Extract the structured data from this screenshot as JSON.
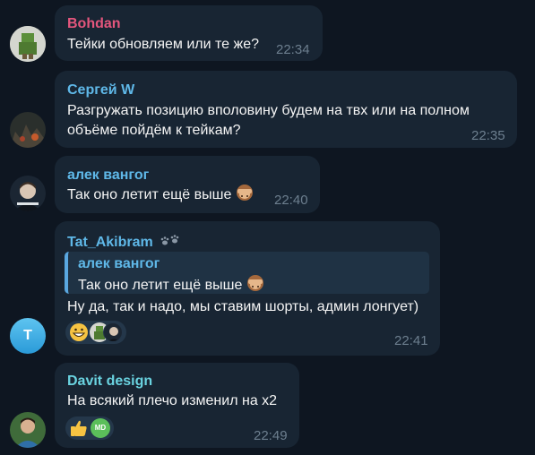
{
  "messages": [
    {
      "sender": "Bohdan",
      "sender_color": "#e4567d",
      "lines": [
        "Тейки обновляем или те же?"
      ],
      "time": "22:34"
    },
    {
      "sender": "Сергей W",
      "sender_color": "#5fb8e8",
      "lines": [
        "Разгружать позицию вполовину будем на твх или на полном",
        "объёме пойдём к тейкам?"
      ],
      "time": "22:35"
    },
    {
      "sender": "алек вангог",
      "sender_color": "#5fb8e8",
      "lines": [
        "Так оно летит ещё выше"
      ],
      "time": "22:40"
    },
    {
      "sender": "Tat_Akibram",
      "sender_color": "#5fb8e8",
      "avatar_letter": "T",
      "quote": {
        "sender": "алек вангог",
        "text": "Так оно летит ещё выше"
      },
      "lines": [
        "Ну да, так и надо, мы ставим шорты, админ лонгует)"
      ],
      "time": "22:41"
    },
    {
      "sender": "Davit design",
      "sender_color": "#6ad3e0",
      "lines": [
        "На всякий плечо изменил на x2"
      ],
      "reaction_initials": "MD",
      "time": "22:49"
    }
  ],
  "icons": {
    "monkey": "see-no-evil-monkey-icon",
    "paw": "paw-prints-icon",
    "grin": "grinning-face-icon",
    "thumbs": "thumbs-up-icon"
  }
}
